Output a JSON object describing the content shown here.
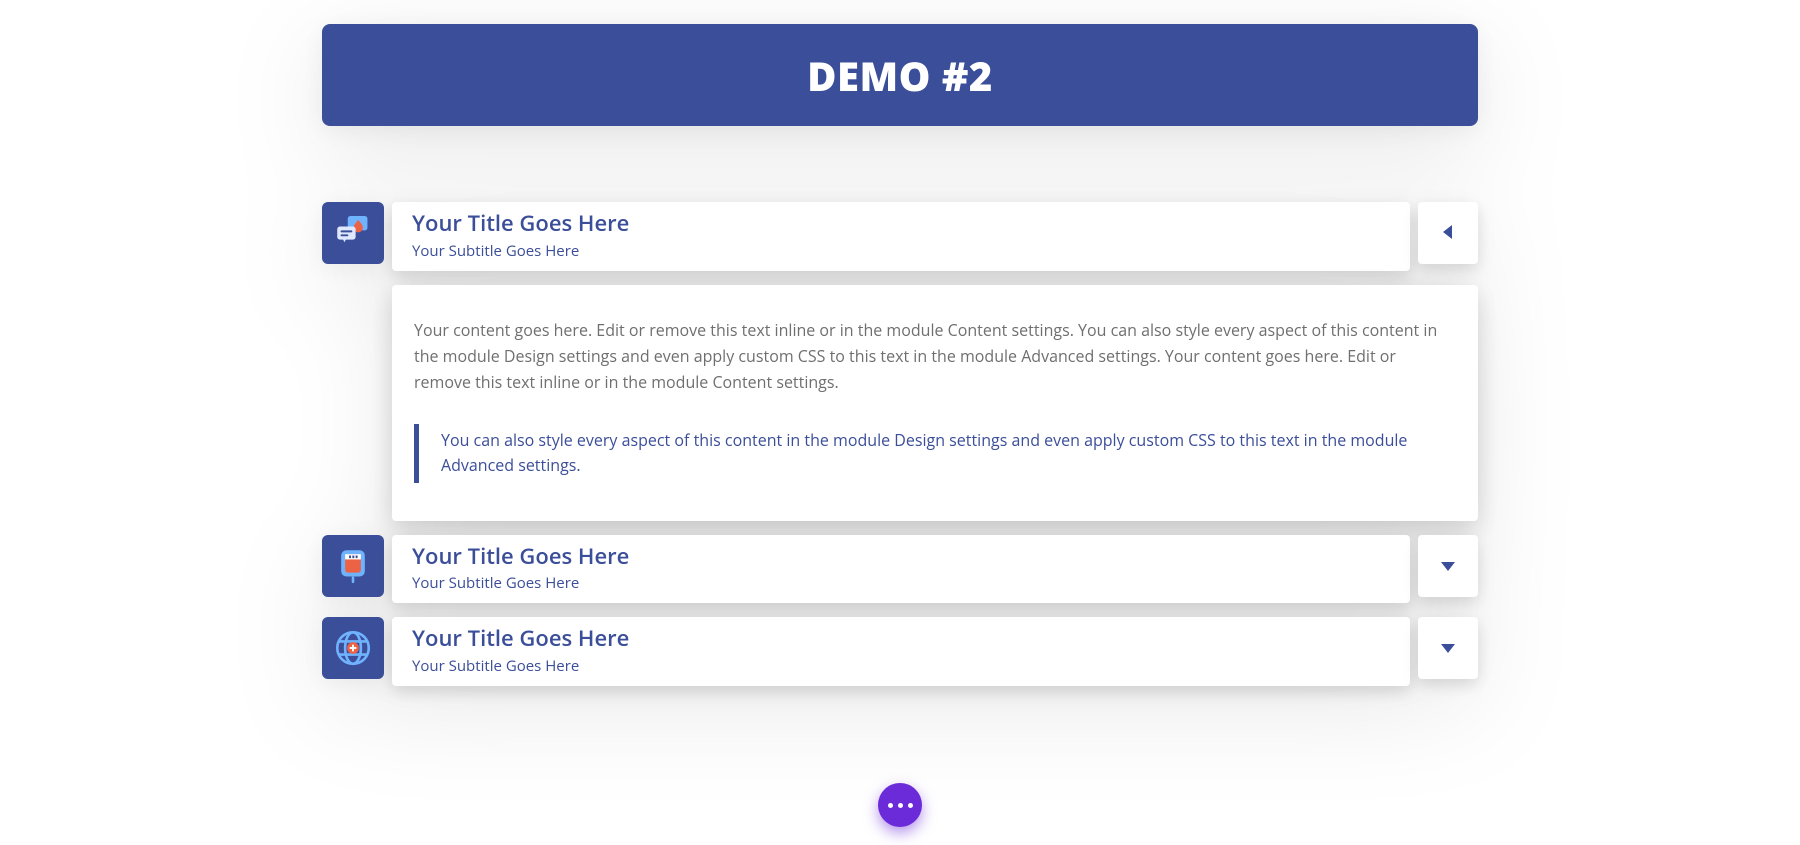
{
  "colors": {
    "primary": "#3b4e99",
    "fab": "#6c2bd9"
  },
  "header": {
    "title": "DEMO #2"
  },
  "accordion": {
    "items": [
      {
        "icon": "chat-drop-icon",
        "title": "Your Title Goes Here",
        "subtitle": "Your Subtitle Goes Here",
        "open": true,
        "body": "Your content goes here. Edit or remove this text inline or in the module Content settings. You can also style every aspect of this content in the module Design settings and even apply custom CSS to this text in the module Advanced settings. Your content goes here. Edit or remove this text inline or in the module Content settings.",
        "quote": "You can also style every aspect of this content in the module Design settings and even apply custom CSS to this text in the module Advanced settings."
      },
      {
        "icon": "blood-bag-icon",
        "title": "Your Title Goes Here",
        "subtitle": "Your Subtitle Goes Here",
        "open": false
      },
      {
        "icon": "globe-medical-icon",
        "title": "Your Title Goes Here",
        "subtitle": "Your Subtitle Goes Here",
        "open": false
      }
    ]
  },
  "fab": {
    "name": "more-actions"
  }
}
